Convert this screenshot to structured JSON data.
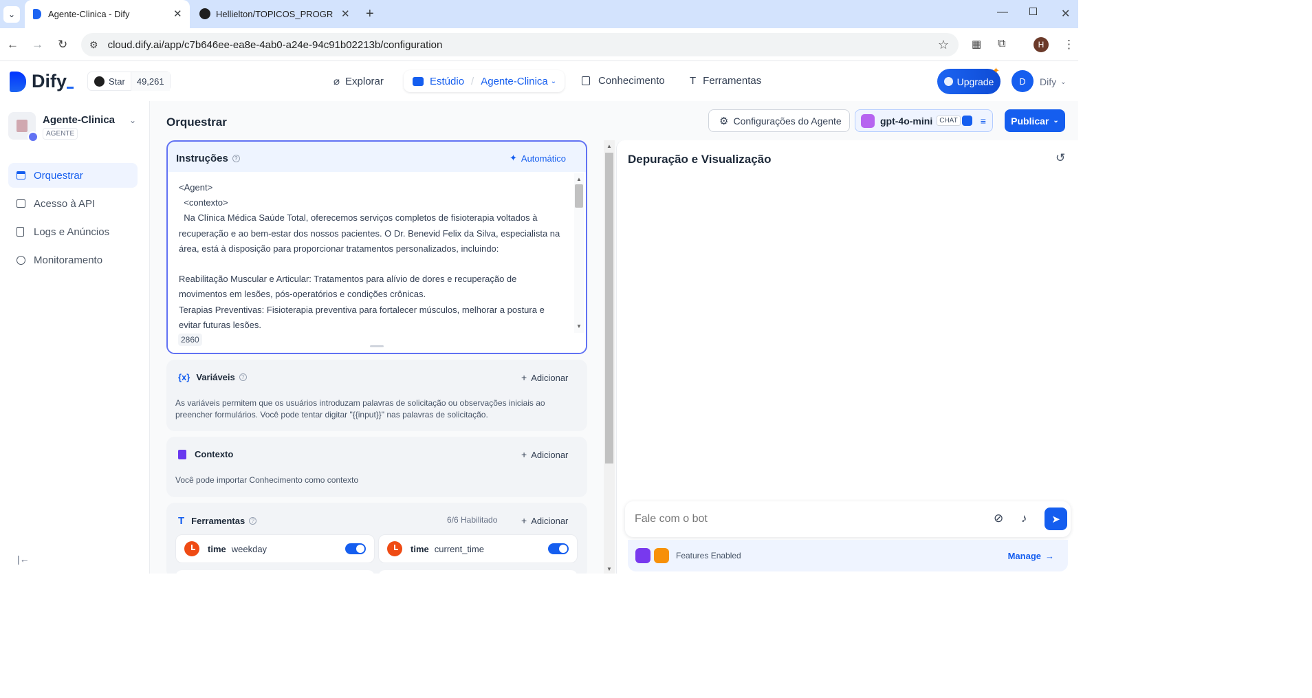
{
  "browser": {
    "tabs": [
      {
        "title": "Agente-Clinica - Dify"
      },
      {
        "title": "Hellielton/TOPICOS_PROGRAM"
      }
    ],
    "url": "cloud.dify.ai/app/c7b646ee-ea8e-4ab0-a24e-94c91b02213b/configuration",
    "profile_initial": "H"
  },
  "header": {
    "logo": "Dify",
    "star_label": "Star",
    "star_count": "49,261",
    "nav": {
      "explore": "Explorar",
      "studio": "Estúdio",
      "app_name": "Agente-Clinica",
      "knowledge": "Conhecimento",
      "tools": "Ferramentas"
    },
    "upgrade": "Upgrade",
    "user_initial": "D",
    "workspace": "Dify"
  },
  "sidebar": {
    "app_name": "Agente-Clinica",
    "app_type": "AGENTE",
    "items": [
      {
        "label": "Orquestrar"
      },
      {
        "label": "Acesso à API"
      },
      {
        "label": "Logs e Anúncios"
      },
      {
        "label": "Monitoramento"
      }
    ]
  },
  "main": {
    "title": "Orquestrar",
    "agent_settings": "Configurações do Agente",
    "model": {
      "name": "gpt-4o-mini",
      "badge": "CHAT"
    },
    "publish": "Publicar",
    "instructions": {
      "title": "Instruções",
      "auto": "Automático",
      "lines": [
        "<Agent>",
        "  <contexto>",
        "  Na Clínica Médica Saúde Total, oferecemos serviços completos de fisioterapia voltados à",
        "recuperação e ao bem-estar dos nossos pacientes. O Dr. Benevid Felix da Silva, especialista na",
        "área, está à disposição para proporcionar tratamentos personalizados, incluindo:",
        "",
        "Reabilitação Muscular e Articular: Tratamentos para alívio de dores e recuperação de",
        "movimentos em lesões, pós-operatórios e condições crônicas.",
        "Terapias Preventivas: Fisioterapia preventiva para fortalecer músculos, melhorar a postura e",
        "evitar futuras lesões."
      ],
      "char_count": "2860"
    },
    "variables": {
      "title": "Variáveis",
      "add": "Adicionar",
      "desc1": "As variáveis permitem que os usuários introduzam palavras de solicitação ou observações iniciais ao",
      "desc2": "preencher formulários. Você pode tentar digitar \"{{input}}\" nas palavras de solicitação."
    },
    "context": {
      "title": "Contexto",
      "add": "Adicionar",
      "desc": "Você pode importar Conhecimento como contexto"
    },
    "tools": {
      "title": "Ferramentas",
      "enabled": "6/6 Habilitado",
      "add": "Adicionar",
      "items": [
        {
          "provider": "time",
          "name": "weekday"
        },
        {
          "provider": "time",
          "name": "current_time"
        }
      ]
    }
  },
  "debug": {
    "title": "Depuração e Visualização",
    "placeholder": "Fale com o bot",
    "features": "Features Enabled",
    "manage": "Manage"
  },
  "colors": {
    "primary": "#155eef",
    "tab_strip": "#d3e3fd",
    "tool_icon": "#ef4b14",
    "feature_purple": "#7839ee",
    "feature_orange": "#f79009"
  }
}
